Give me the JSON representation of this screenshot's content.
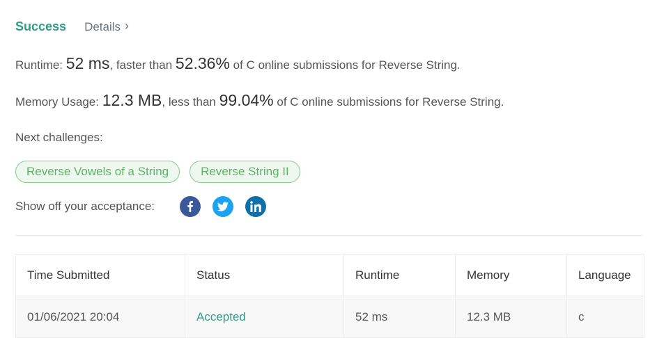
{
  "header": {
    "status": "Success",
    "details_label": "Details",
    "chevron": "›"
  },
  "runtime": {
    "label": "Runtime:",
    "value": "52 ms",
    "comparison_prefix": ", faster than",
    "percent": "52.36%",
    "suffix": "of C online submissions for Reverse String."
  },
  "memory": {
    "label": "Memory Usage:",
    "value": "12.3 MB",
    "comparison_prefix": ", less than",
    "percent": "99.04%",
    "suffix": "of C online submissions for Reverse String."
  },
  "next": {
    "label": "Next challenges:",
    "challenges": [
      "Reverse Vowels of a String",
      "Reverse String II"
    ]
  },
  "share": {
    "label": "Show off your acceptance:",
    "icons": [
      "facebook-icon",
      "twitter-icon",
      "linkedin-icon"
    ]
  },
  "table": {
    "columns": [
      "Time Submitted",
      "Status",
      "Runtime",
      "Memory",
      "Language"
    ],
    "rows": [
      [
        "01/06/2021 20:04",
        "Accepted",
        "52 ms",
        "12.3 MB",
        "c"
      ]
    ]
  },
  "colors": {
    "success": "#2f9c87",
    "chip_border": "#88c98e",
    "chip_text": "#5ab565",
    "facebook": "#3b5998",
    "twitter": "#1da1f2",
    "linkedin": "#0f6fa8"
  }
}
